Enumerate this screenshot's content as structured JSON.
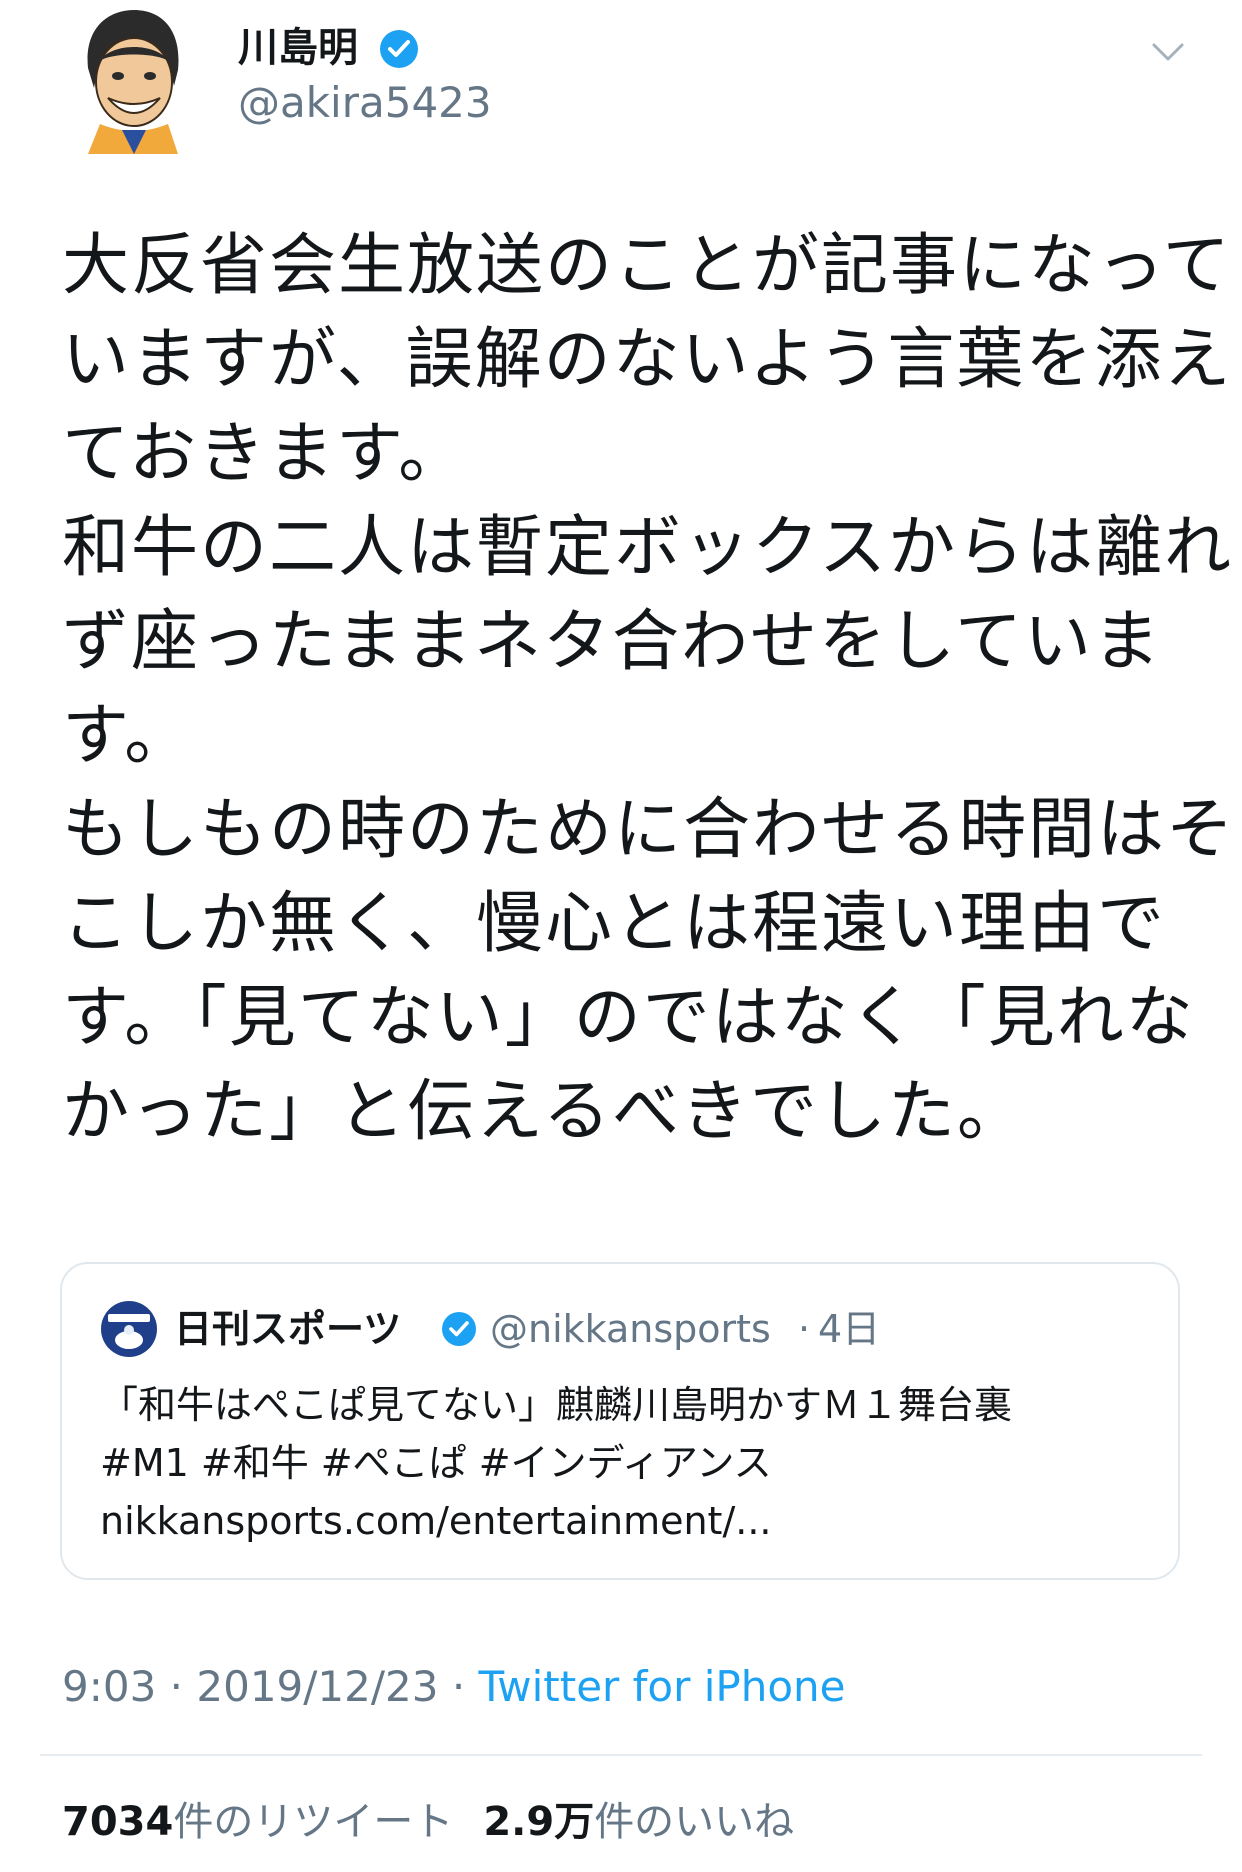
{
  "author": {
    "name": "川島明",
    "handle": "@akira5423",
    "verified_icon": "verified-badge-icon",
    "more_icon": "chevron-down-icon"
  },
  "tweet": {
    "lines": [
      "大反省会生放送のことが記事になって",
      "いますが、誤解のないよう言葉を添え",
      "ておきます。",
      "和牛の二人は暫定ボックスからは離れ",
      "ず座ったままネタ合わせをしていま",
      "す。",
      "もしもの時のために合わせる時間はそ",
      "こしか無く、慢心とは程遠い理由で",
      "す。「見てない」のではなく「見れな",
      "かった」と伝えるべきでした。"
    ]
  },
  "quote": {
    "name": "日刊スポーツ",
    "handle": "@nikkansports",
    "separator": "·",
    "time": "4日",
    "lines": [
      "「和牛はぺこぱ見てない」麒麟川島明かすＭ１舞台裏",
      "#M1 #和牛 #ぺこぱ #インディアンス",
      "nikkansports.com/entertainment/..."
    ]
  },
  "meta": {
    "time": "9:03",
    "dot1": " · ",
    "date": "2019/12/23",
    "dot2": " · ",
    "source": "Twitter for iPhone"
  },
  "stats": {
    "retweet_count": "7034",
    "retweet_label": "件のリツイート",
    "like_count": "2.9万",
    "like_label": "件のいいね"
  },
  "colors": {
    "accent": "#1da1f2",
    "secondary_text": "#657786",
    "border": "#e1e8ed"
  }
}
